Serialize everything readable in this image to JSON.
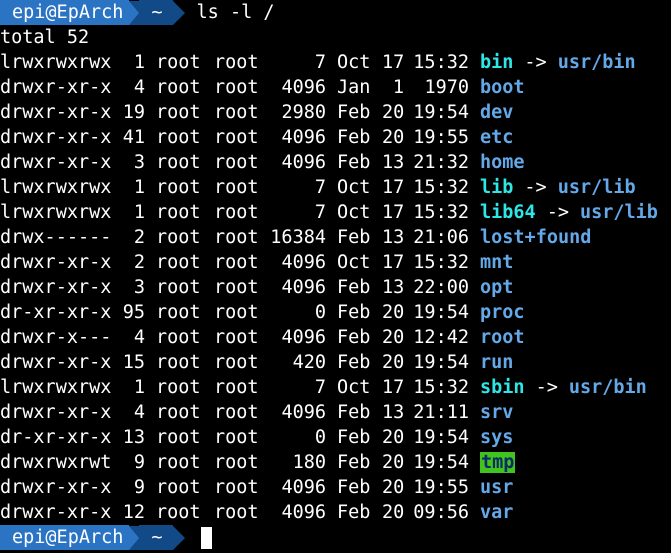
{
  "window": {
    "background": "#000000",
    "prompt_user_bg": "#2b74c4",
    "prompt_dir_bg": "#124a88"
  },
  "prompt": {
    "user_host": "epi@EpArch",
    "dir": "~",
    "command": "ls -l /"
  },
  "total_line": "total 52",
  "entries": [
    {
      "perm": "lrwxrwxrwx",
      "links": "1",
      "owner": "root",
      "group": "root",
      "size": "7",
      "month": "Oct",
      "day": "17",
      "time": "15:32",
      "name": "bin",
      "kind": "link",
      "arrow": "->",
      "target": "usr/bin"
    },
    {
      "perm": "drwxr-xr-x",
      "links": "4",
      "owner": "root",
      "group": "root",
      "size": "4096",
      "month": "Jan",
      "day": "1",
      "time": "1970",
      "name": "boot",
      "kind": "dir",
      "arrow": "",
      "target": ""
    },
    {
      "perm": "drwxr-xr-x",
      "links": "19",
      "owner": "root",
      "group": "root",
      "size": "2980",
      "month": "Feb",
      "day": "20",
      "time": "19:54",
      "name": "dev",
      "kind": "dir",
      "arrow": "",
      "target": ""
    },
    {
      "perm": "drwxr-xr-x",
      "links": "41",
      "owner": "root",
      "group": "root",
      "size": "4096",
      "month": "Feb",
      "day": "20",
      "time": "19:55",
      "name": "etc",
      "kind": "dir",
      "arrow": "",
      "target": ""
    },
    {
      "perm": "drwxr-xr-x",
      "links": "3",
      "owner": "root",
      "group": "root",
      "size": "4096",
      "month": "Feb",
      "day": "13",
      "time": "21:32",
      "name": "home",
      "kind": "dir",
      "arrow": "",
      "target": ""
    },
    {
      "perm": "lrwxrwxrwx",
      "links": "1",
      "owner": "root",
      "group": "root",
      "size": "7",
      "month": "Oct",
      "day": "17",
      "time": "15:32",
      "name": "lib",
      "kind": "link",
      "arrow": "->",
      "target": "usr/lib"
    },
    {
      "perm": "lrwxrwxrwx",
      "links": "1",
      "owner": "root",
      "group": "root",
      "size": "7",
      "month": "Oct",
      "day": "17",
      "time": "15:32",
      "name": "lib64",
      "kind": "link",
      "arrow": "->",
      "target": "usr/lib"
    },
    {
      "perm": "drwx------",
      "links": "2",
      "owner": "root",
      "group": "root",
      "size": "16384",
      "month": "Feb",
      "day": "13",
      "time": "21:06",
      "name": "lost+found",
      "kind": "dir",
      "arrow": "",
      "target": ""
    },
    {
      "perm": "drwxr-xr-x",
      "links": "2",
      "owner": "root",
      "group": "root",
      "size": "4096",
      "month": "Oct",
      "day": "17",
      "time": "15:32",
      "name": "mnt",
      "kind": "dir",
      "arrow": "",
      "target": ""
    },
    {
      "perm": "drwxr-xr-x",
      "links": "3",
      "owner": "root",
      "group": "root",
      "size": "4096",
      "month": "Feb",
      "day": "13",
      "time": "22:00",
      "name": "opt",
      "kind": "dir",
      "arrow": "",
      "target": ""
    },
    {
      "perm": "dr-xr-xr-x",
      "links": "95",
      "owner": "root",
      "group": "root",
      "size": "0",
      "month": "Feb",
      "day": "20",
      "time": "19:54",
      "name": "proc",
      "kind": "dir",
      "arrow": "",
      "target": ""
    },
    {
      "perm": "drwxr-x---",
      "links": "4",
      "owner": "root",
      "group": "root",
      "size": "4096",
      "month": "Feb",
      "day": "20",
      "time": "12:42",
      "name": "root",
      "kind": "dir",
      "arrow": "",
      "target": ""
    },
    {
      "perm": "drwxr-xr-x",
      "links": "15",
      "owner": "root",
      "group": "root",
      "size": "420",
      "month": "Feb",
      "day": "20",
      "time": "19:54",
      "name": "run",
      "kind": "dir",
      "arrow": "",
      "target": ""
    },
    {
      "perm": "lrwxrwxrwx",
      "links": "1",
      "owner": "root",
      "group": "root",
      "size": "7",
      "month": "Oct",
      "day": "17",
      "time": "15:32",
      "name": "sbin",
      "kind": "link",
      "arrow": "->",
      "target": "usr/bin"
    },
    {
      "perm": "drwxr-xr-x",
      "links": "4",
      "owner": "root",
      "group": "root",
      "size": "4096",
      "month": "Feb",
      "day": "13",
      "time": "21:11",
      "name": "srv",
      "kind": "dir",
      "arrow": "",
      "target": ""
    },
    {
      "perm": "dr-xr-xr-x",
      "links": "13",
      "owner": "root",
      "group": "root",
      "size": "0",
      "month": "Feb",
      "day": "20",
      "time": "19:54",
      "name": "sys",
      "kind": "dir",
      "arrow": "",
      "target": ""
    },
    {
      "perm": "drwxrwxrwt",
      "links": "9",
      "owner": "root",
      "group": "root",
      "size": "180",
      "month": "Feb",
      "day": "20",
      "time": "19:54",
      "name": "tmp",
      "kind": "sticky",
      "arrow": "",
      "target": ""
    },
    {
      "perm": "drwxr-xr-x",
      "links": "9",
      "owner": "root",
      "group": "root",
      "size": "4096",
      "month": "Feb",
      "day": "20",
      "time": "19:55",
      "name": "usr",
      "kind": "dir",
      "arrow": "",
      "target": ""
    },
    {
      "perm": "drwxr-xr-x",
      "links": "12",
      "owner": "root",
      "group": "root",
      "size": "4096",
      "month": "Feb",
      "day": "20",
      "time": "09:56",
      "name": "var",
      "kind": "dir",
      "arrow": "",
      "target": ""
    }
  ],
  "prompt_bottom": {
    "user_host": "epi@EpArch",
    "dir": "~"
  }
}
